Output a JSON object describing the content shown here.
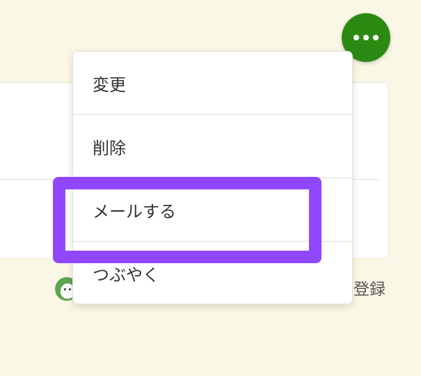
{
  "background": {
    "register_text": "登録"
  },
  "more_button": {
    "icon": "ellipsis-icon",
    "color": "#2b8a12"
  },
  "menu": {
    "items": [
      {
        "label": "変更"
      },
      {
        "label": "削除"
      },
      {
        "label": "メールする"
      },
      {
        "label": "つぶやく"
      }
    ]
  },
  "highlight": {
    "target": "メールする",
    "color": "#8f48ff"
  }
}
